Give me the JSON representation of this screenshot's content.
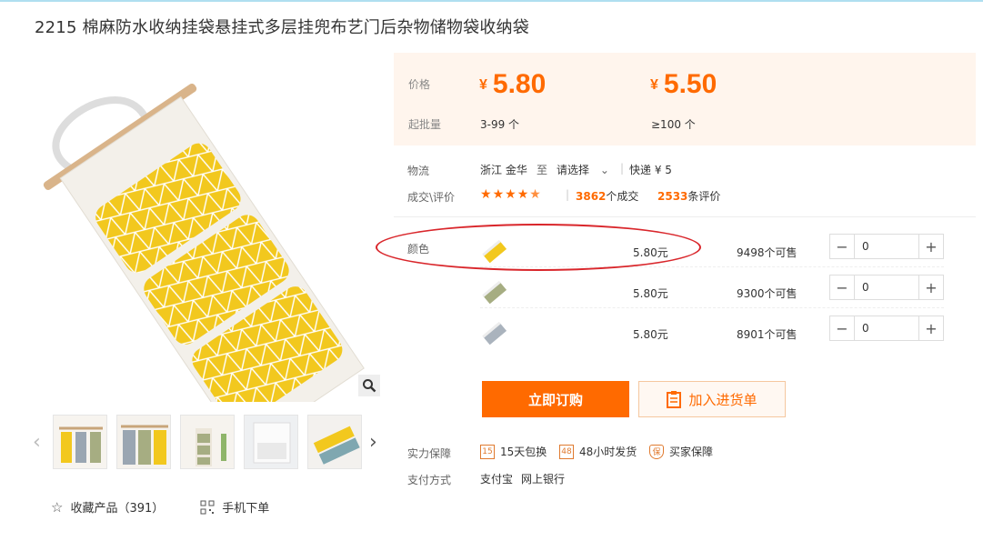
{
  "title": "2215 棉麻防水收纳挂袋悬挂式多层挂兜布艺门后杂物储物袋收纳袋",
  "price_panel": {
    "price_label": "价格",
    "prices": [
      {
        "currency": "¥",
        "amount": "5.80",
        "range": "3-99 个"
      },
      {
        "currency": "¥",
        "amount": "5.50",
        "range": "≥100 个"
      }
    ],
    "moq_label": "起批量"
  },
  "logistics": {
    "label": "物流",
    "from": "浙江 金华",
    "to_word": "至",
    "select": "请选择",
    "express": "快递 ¥ 5"
  },
  "rating": {
    "label": "成交\\评价",
    "stars": 4.5,
    "deals_count": "3862",
    "deals_suffix": "个成交",
    "reviews_count": "2533",
    "reviews_suffix": "条评价"
  },
  "sku": {
    "label": "颜色",
    "rows": [
      {
        "color_variant": "yellow",
        "price": "5.80元",
        "available": "9498个可售",
        "qty": "0"
      },
      {
        "color_variant": "green",
        "price": "5.80元",
        "available": "9300个可售",
        "qty": "0"
      },
      {
        "color_variant": "grey",
        "price": "5.80元",
        "available": "8901个可售",
        "qty": "0"
      }
    ]
  },
  "buttons": {
    "order": "立即订购",
    "cart": "加入进货单"
  },
  "guarantee": {
    "label": "实力保障",
    "items": [
      {
        "icon": "15",
        "text": "15天包换"
      },
      {
        "icon": "48",
        "text": "48小时发货"
      },
      {
        "icon": "保",
        "text": "买家保障"
      }
    ]
  },
  "payment": {
    "label": "支付方式",
    "methods": [
      "支付宝",
      "网上银行"
    ]
  },
  "left_actions": {
    "favorite": "收藏产品（391）",
    "mobile": "手机下单"
  },
  "colors": {
    "accent": "#ff6a00",
    "panel_bg": "#fff5ed",
    "annotation": "#d9262b",
    "yellow": "#f2c81e"
  }
}
